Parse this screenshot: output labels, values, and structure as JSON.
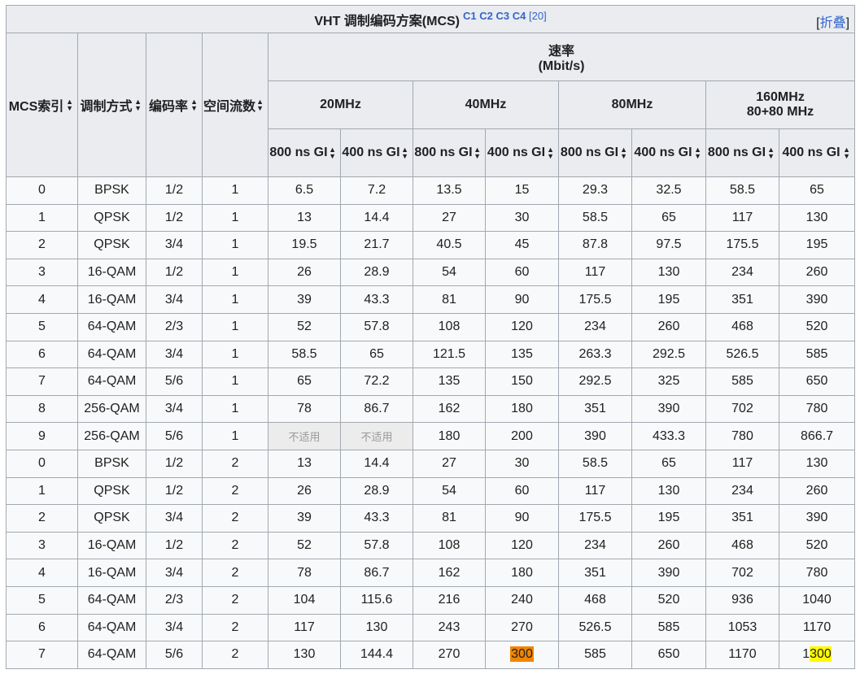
{
  "caption": {
    "title": "VHT 调制编码方案(MCS)",
    "links": [
      "C1",
      "C2",
      "C3",
      "C4"
    ],
    "ref": "[20]",
    "toggle_open": "[",
    "toggle_label": "折叠",
    "toggle_close": "]"
  },
  "headers": {
    "mcs_index": "MCS索引",
    "modulation": "调制方式",
    "coding_rate": "编码率",
    "spatial_streams": "空间流数",
    "rate_line1": "速率",
    "rate_line2": "(Mbit/s)",
    "bw20": "20MHz",
    "bw40": "40MHz",
    "bw80": "80MHz",
    "bw160_line1": "160MHz",
    "bw160_line2": "80+80 MHz",
    "gi800": "800 ns GI",
    "gi400": "400 ns GI"
  },
  "rows": [
    {
      "mcs": "0",
      "mod": "BPSK",
      "rate": "1/2",
      "ss": "1",
      "v": [
        "6.5",
        "7.2",
        "13.5",
        "15",
        "29.3",
        "32.5",
        "58.5",
        "65"
      ]
    },
    {
      "mcs": "1",
      "mod": "QPSK",
      "rate": "1/2",
      "ss": "1",
      "v": [
        "13",
        "14.4",
        "27",
        "30",
        "58.5",
        "65",
        "117",
        "130"
      ]
    },
    {
      "mcs": "2",
      "mod": "QPSK",
      "rate": "3/4",
      "ss": "1",
      "v": [
        "19.5",
        "21.7",
        "40.5",
        "45",
        "87.8",
        "97.5",
        "175.5",
        "195"
      ]
    },
    {
      "mcs": "3",
      "mod": "16-QAM",
      "rate": "1/2",
      "ss": "1",
      "v": [
        "26",
        "28.9",
        "54",
        "60",
        "117",
        "130",
        "234",
        "260"
      ]
    },
    {
      "mcs": "4",
      "mod": "16-QAM",
      "rate": "3/4",
      "ss": "1",
      "v": [
        "39",
        "43.3",
        "81",
        "90",
        "175.5",
        "195",
        "351",
        "390"
      ]
    },
    {
      "mcs": "5",
      "mod": "64-QAM",
      "rate": "2/3",
      "ss": "1",
      "v": [
        "52",
        "57.8",
        "108",
        "120",
        "234",
        "260",
        "468",
        "520"
      ]
    },
    {
      "mcs": "6",
      "mod": "64-QAM",
      "rate": "3/4",
      "ss": "1",
      "v": [
        "58.5",
        "65",
        "121.5",
        "135",
        "263.3",
        "292.5",
        "526.5",
        "585"
      ]
    },
    {
      "mcs": "7",
      "mod": "64-QAM",
      "rate": "5/6",
      "ss": "1",
      "v": [
        "65",
        "72.2",
        "135",
        "150",
        "292.5",
        "325",
        "585",
        "650"
      ]
    },
    {
      "mcs": "8",
      "mod": "256-QAM",
      "rate": "3/4",
      "ss": "1",
      "v": [
        "78",
        "86.7",
        "162",
        "180",
        "351",
        "390",
        "702",
        "780"
      ]
    },
    {
      "mcs": "9",
      "mod": "256-QAM",
      "rate": "5/6",
      "ss": "1",
      "v": [
        "不适用",
        "不适用",
        "180",
        "200",
        "390",
        "433.3",
        "780",
        "866.7"
      ]
    },
    {
      "mcs": "0",
      "mod": "BPSK",
      "rate": "1/2",
      "ss": "2",
      "v": [
        "13",
        "14.4",
        "27",
        "30",
        "58.5",
        "65",
        "117",
        "130"
      ]
    },
    {
      "mcs": "1",
      "mod": "QPSK",
      "rate": "1/2",
      "ss": "2",
      "v": [
        "26",
        "28.9",
        "54",
        "60",
        "117",
        "130",
        "234",
        "260"
      ]
    },
    {
      "mcs": "2",
      "mod": "QPSK",
      "rate": "3/4",
      "ss": "2",
      "v": [
        "39",
        "43.3",
        "81",
        "90",
        "175.5",
        "195",
        "351",
        "390"
      ]
    },
    {
      "mcs": "3",
      "mod": "16-QAM",
      "rate": "1/2",
      "ss": "2",
      "v": [
        "52",
        "57.8",
        "108",
        "120",
        "234",
        "260",
        "468",
        "520"
      ]
    },
    {
      "mcs": "4",
      "mod": "16-QAM",
      "rate": "3/4",
      "ss": "2",
      "v": [
        "78",
        "86.7",
        "162",
        "180",
        "351",
        "390",
        "702",
        "780"
      ]
    },
    {
      "mcs": "5",
      "mod": "64-QAM",
      "rate": "2/3",
      "ss": "2",
      "v": [
        "104",
        "115.6",
        "216",
        "240",
        "468",
        "520",
        "936",
        "1040"
      ]
    },
    {
      "mcs": "6",
      "mod": "64-QAM",
      "rate": "3/4",
      "ss": "2",
      "v": [
        "117",
        "130",
        "243",
        "270",
        "526.5",
        "585",
        "1053",
        "1170"
      ]
    },
    {
      "mcs": "7",
      "mod": "64-QAM",
      "rate": "5/6",
      "ss": "2",
      "v": [
        "130",
        "144.4",
        "270",
        "300",
        "585",
        "650",
        "1170",
        "1300"
      ]
    }
  ],
  "highlights": {
    "orange_color": "#f28500",
    "yellow_color": "#fffa00",
    "na_text": "不适用"
  }
}
